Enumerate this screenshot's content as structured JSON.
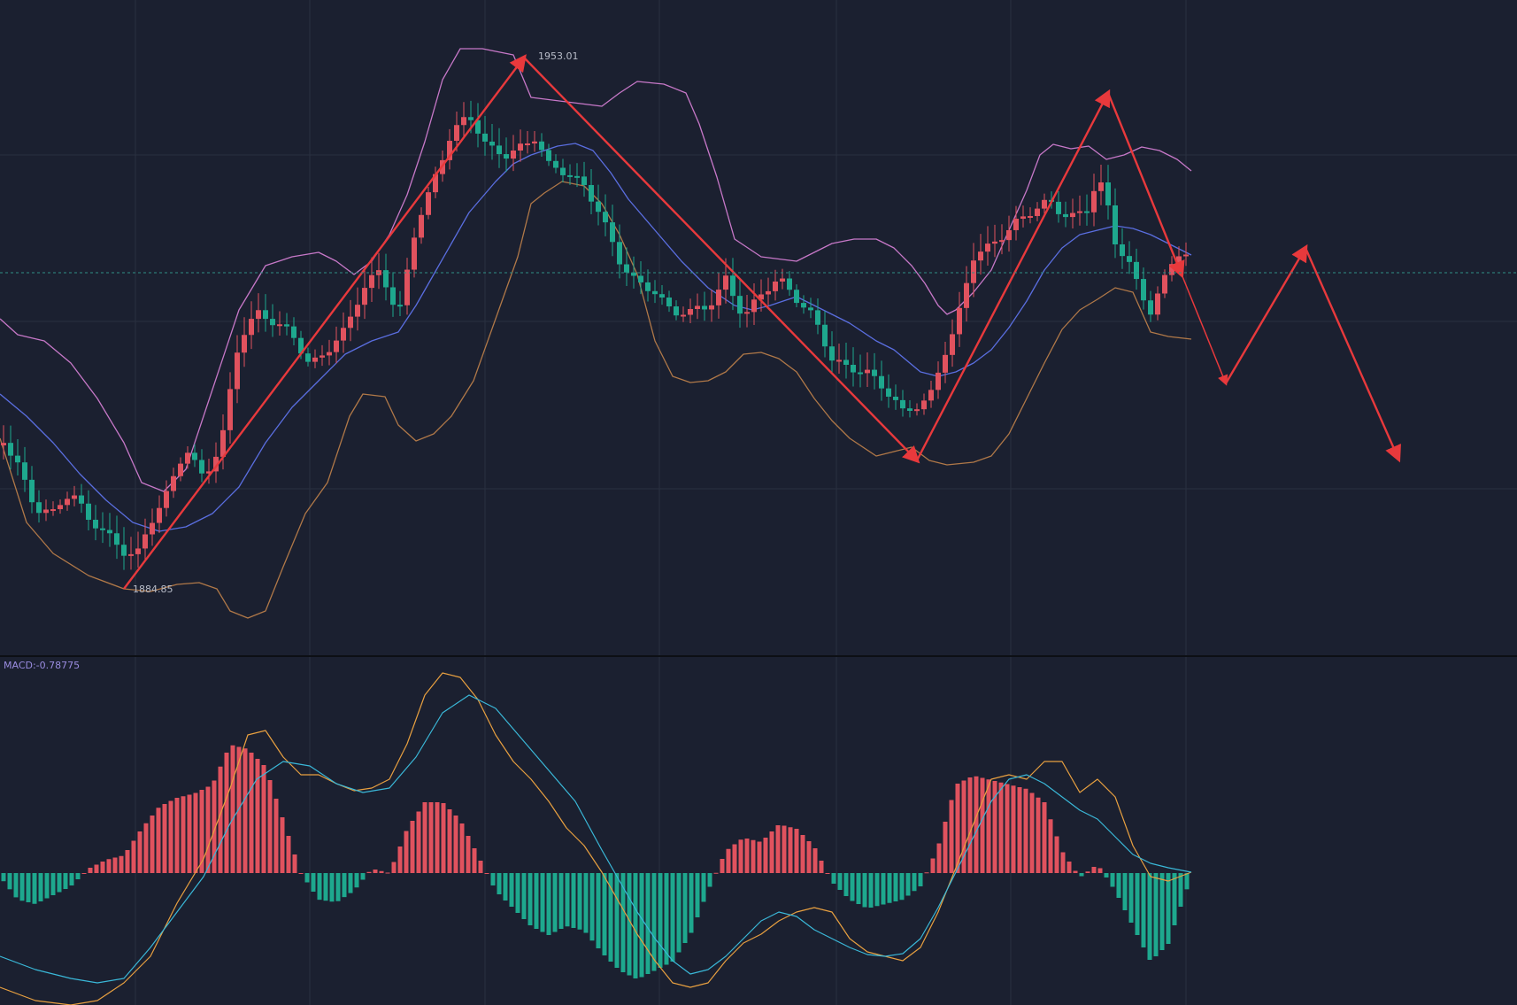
{
  "chart_data": {
    "type": "candlestick",
    "title": "",
    "colors": {
      "background": "#1b2030",
      "up": "#e0525e",
      "down": "#1ea88e",
      "upper_band": "#c778c8",
      "middle_band": "#5a6ee0",
      "lower_band": "#b07848",
      "trend_arrows": "#e8393c",
      "macd_line": "#e8a040",
      "signal_line": "#3ab8d8",
      "grid": "#2a3040",
      "separator": "#111318"
    },
    "price_panel": {
      "annotations": [
        {
          "text": "1953.01",
          "type": "high"
        },
        {
          "text": "1884.85",
          "type": "low"
        }
      ],
      "current_price_line": true,
      "high": 1953.01,
      "low": 1884.85
    },
    "indicator_panel": {
      "label": "MACD:-0.78775",
      "value": -0.78775
    },
    "trend_path_description": "zigzag",
    "grid": true
  }
}
